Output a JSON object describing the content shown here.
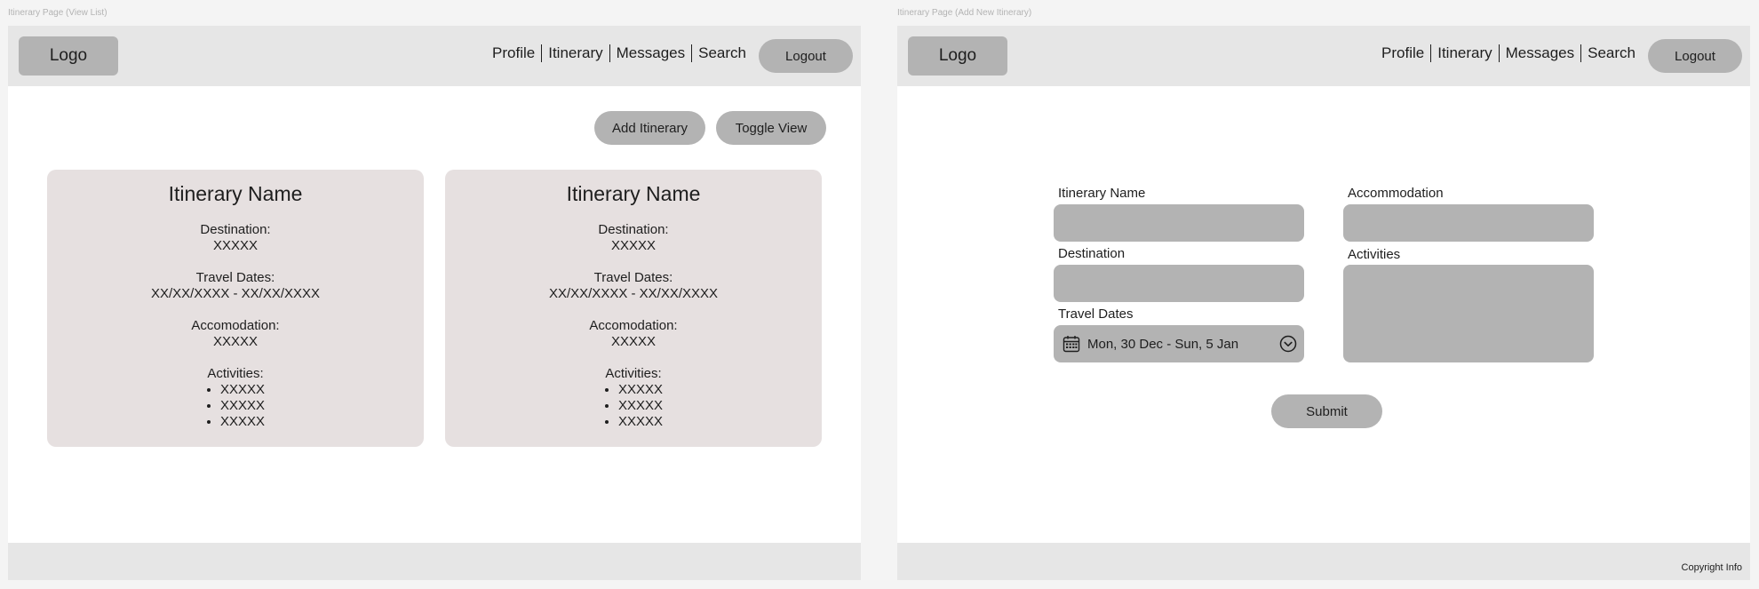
{
  "frames": {
    "left_label": "Itinerary Page (View List)",
    "right_label": "Itinerary Page (Add New Itinerary)"
  },
  "nav": {
    "logo": "Logo",
    "links": [
      "Profile",
      "Itinerary",
      "Messages",
      "Search"
    ],
    "logout": "Logout"
  },
  "list_page": {
    "add_button": "Add Itinerary",
    "toggle_button": "Toggle View",
    "cards": [
      {
        "title": "Itinerary Name",
        "destination_label": "Destination:",
        "destination_value": "XXXXX",
        "dates_label": "Travel Dates:",
        "dates_value": "XX/XX/XXXX - XX/XX/XXXX",
        "accommodation_label": "Accomodation:",
        "accommodation_value": "XXXXX",
        "activities_label": "Activities:",
        "activities": [
          "XXXXX",
          "XXXXX",
          "XXXXX"
        ]
      },
      {
        "title": "Itinerary Name",
        "destination_label": "Destination:",
        "destination_value": "XXXXX",
        "dates_label": "Travel Dates:",
        "dates_value": "XX/XX/XXXX - XX/XX/XXXX",
        "accommodation_label": "Accomodation:",
        "accommodation_value": "XXXXX",
        "activities_label": "Activities:",
        "activities": [
          "XXXXX",
          "XXXXX",
          "XXXXX"
        ]
      }
    ]
  },
  "add_page": {
    "name_label": "Itinerary Name",
    "name_value": "",
    "destination_label": "Destination",
    "destination_value": "",
    "dates_label": "Travel Dates",
    "dates_value": "Mon, 30 Dec - Sun, 5 Jan",
    "accommodation_label": "Accommodation",
    "accommodation_value": "",
    "activities_label": "Activities",
    "activities_value": "",
    "submit_button": "Submit"
  },
  "footer": {
    "copyright": "Copyright Info"
  },
  "icons": {
    "calendar": "calendar-icon",
    "dropdown": "chevron-down-circle-icon"
  },
  "colors": {
    "background": "#f4f4f4",
    "bar": "#e6e6e6",
    "control": "#b3b3b3",
    "card": "#e6e0e0",
    "text": "#1e1e1e"
  }
}
